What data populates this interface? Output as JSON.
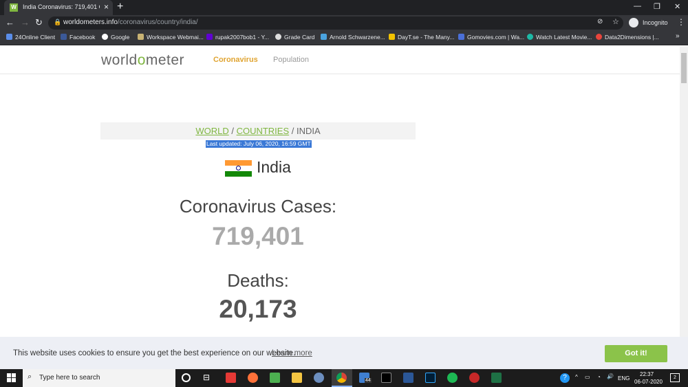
{
  "browser": {
    "tab_title": "India Coronavirus: 719,401 Cases",
    "tab_favicon": "W",
    "url_host": "worldometers.info",
    "url_path": "/coronavirus/country/india/",
    "profile": "Incognito",
    "bookmarks": [
      "24Online Client",
      "Facebook",
      "Google",
      "Workspace Webmai...",
      "rupak2007bob1 - Y...",
      "Grade Card",
      "Arnold Schwarzene...",
      "DayT.se - The Many...",
      "Gomovies.com | Wa...",
      "Watch Latest Movie...",
      "Data2Dimensions |..."
    ],
    "bookmarks_more": "»"
  },
  "site": {
    "logo_pre": "world",
    "logo_o": "o",
    "logo_post": "meter",
    "nav": {
      "coronavirus": "Coronavirus",
      "population": "Population"
    },
    "breadcrumb": {
      "world": "WORLD",
      "sep1": " / ",
      "countries": "COUNTRIES",
      "sep2": " / ",
      "current": "INDIA"
    },
    "last_updated": "Last updated: July 06, 2020, 16:59 GMT",
    "country": "India",
    "cases_label": "Coronavirus Cases:",
    "cases": "719,401",
    "deaths_label": "Deaths:",
    "deaths": "20,173"
  },
  "cookie": {
    "message": "This website uses cookies to ensure you get the best experience on our website.",
    "learn_more": "Learn more",
    "button": "Got it!"
  },
  "taskbar": {
    "search_placeholder": "Type here to search",
    "time": "22:37",
    "date": "06-07-2020",
    "lang": "ENG",
    "word_badge": "44",
    "notif": "2"
  },
  "colors": {
    "accent_green": "#7fb640",
    "nav_orange": "#e0a431",
    "cookie_btn": "#8bc34a"
  }
}
